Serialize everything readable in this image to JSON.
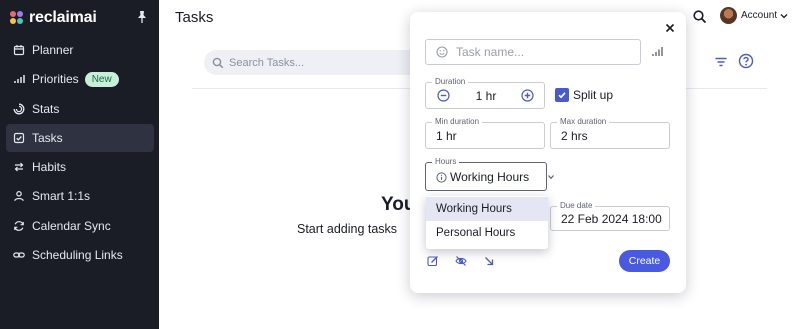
{
  "brand": {
    "name": "reclaimai"
  },
  "sidebar": {
    "items": [
      {
        "label": "Planner",
        "icon": "calendar-icon"
      },
      {
        "label": "Priorities",
        "icon": "bars-icon",
        "badge": "New"
      },
      {
        "label": "Stats",
        "icon": "stats-icon"
      },
      {
        "label": "Tasks",
        "icon": "task-check-icon",
        "active": true
      },
      {
        "label": "Habits",
        "icon": "repeat-icon"
      },
      {
        "label": "Smart 1:1s",
        "icon": "people-icon"
      },
      {
        "label": "Calendar Sync",
        "icon": "sync-icon"
      },
      {
        "label": "Scheduling Links",
        "icon": "link-icon"
      }
    ]
  },
  "header": {
    "title": "Tasks",
    "account_label": "Account"
  },
  "toolbar": {
    "search_placeholder": "Search Tasks..."
  },
  "empty_state": {
    "title": "You",
    "subtitle": "Start adding tasks"
  },
  "modal": {
    "task_name_placeholder": "Task name...",
    "duration": {
      "label": "Duration",
      "value": "1 hr"
    },
    "split_up": {
      "label": "Split up",
      "checked": true
    },
    "min_duration": {
      "label": "Min duration",
      "value": "1 hr"
    },
    "max_duration": {
      "label": "Max duration",
      "value": "2 hrs"
    },
    "hours": {
      "label": "Hours",
      "value": "Working Hours"
    },
    "hours_options": [
      "Working Hours",
      "Personal Hours"
    ],
    "due_date": {
      "label": "Due date",
      "value": "22 Feb 2024 18:00"
    },
    "create_label": "Create"
  },
  "colors": {
    "sidebar_bg": "#1b1d26",
    "accent": "#4a5ae0",
    "badge_bg": "#c8efd8",
    "badge_text": "#1e6b41"
  }
}
